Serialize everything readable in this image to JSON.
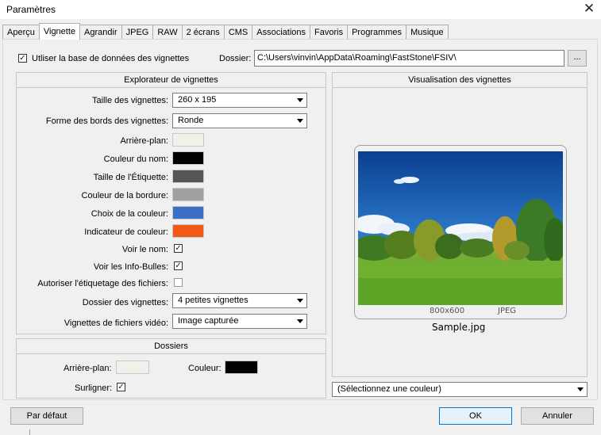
{
  "window": {
    "title": "Paramètres"
  },
  "tabs": [
    {
      "label": "Aperçu"
    },
    {
      "label": "Vignette"
    },
    {
      "label": "Agrandir"
    },
    {
      "label": "JPEG"
    },
    {
      "label": "RAW"
    },
    {
      "label": "2 écrans"
    },
    {
      "label": "CMS"
    },
    {
      "label": "Associations"
    },
    {
      "label": "Favoris"
    },
    {
      "label": "Programmes"
    },
    {
      "label": "Musique"
    }
  ],
  "top": {
    "use_db_label": "Utliser la base de données des vignettes",
    "use_db_checked": true,
    "folder_label": "Dossier:",
    "folder_value": "C:\\Users\\vinvin\\AppData\\Roaming\\FastStone\\FSIV\\",
    "browse_label": "..."
  },
  "explorer": {
    "title": "Explorateur de vignettes",
    "thumb_size_label": "Taille des vignettes:",
    "thumb_size_value": "260 x 195",
    "border_shape_label": "Forme des bords des vignettes:",
    "border_shape_value": "Ronde",
    "background_label": "Arrière-plan:",
    "name_color_label": "Couleur du nom:",
    "tag_size_label": "Taille de l'Étiquette:",
    "border_color_label": "Couleur de la bordure:",
    "choice_color_label": "Choix de la couleur:",
    "indicator_color_label": "Indicateur de couleur:",
    "show_name_label": "Voir le nom:",
    "show_tooltips_label": "Voir les Info-Bulles:",
    "allow_tagging_label": "Autoriser l'étiquetage des fichiers:",
    "thumb_folder_label": "Dossier des vignettes:",
    "thumb_folder_value": "4 petites vignettes",
    "video_thumbs_label": "Vignettes de fichiers vidéo:",
    "video_thumbs_value": "Image capturée",
    "show_name_checked": true,
    "show_tooltips_checked": true,
    "allow_tagging_checked": false
  },
  "colors": {
    "background": "#f1f1ec",
    "name": "#000000",
    "tag": "#555555",
    "border": "#a0a0a0",
    "choice": "#3a6fc4",
    "indicator": "#f05a14",
    "folders_background": "#f1f1ec",
    "folders_color": "#000000"
  },
  "folders": {
    "title": "Dossiers",
    "background_label": "Arrière-plan:",
    "color_label": "Couleur:",
    "highlight_label": "Surligner:",
    "highlight_checked": true
  },
  "preview": {
    "title": "Visualisation des vignettes",
    "dimensions": "800x600",
    "format": "JPEG",
    "filename": "Sample.jpg",
    "color_select_value": "(Sélectionnez une couleur)"
  },
  "buttons": {
    "default_label": "Par défaut",
    "ok_label": "OK",
    "cancel_label": "Annuler"
  }
}
